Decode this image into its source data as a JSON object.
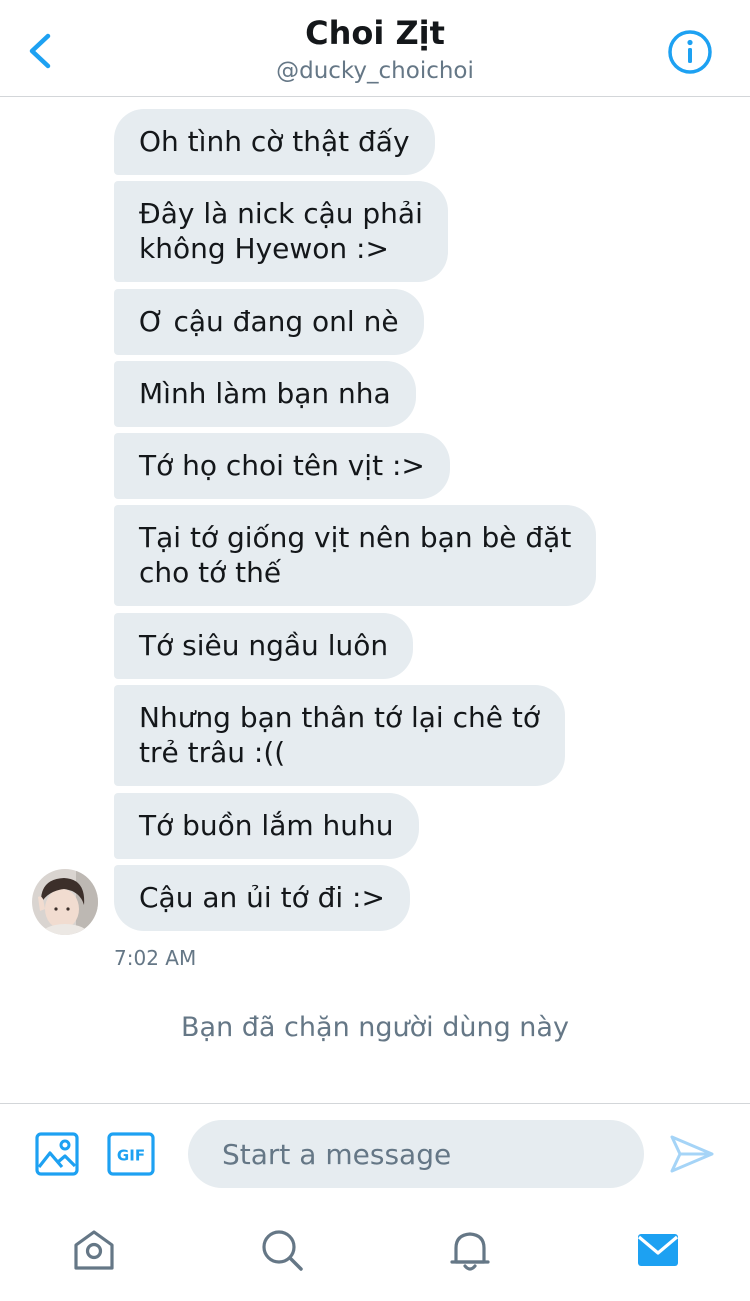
{
  "header": {
    "title": "Choi Zịt",
    "handle": "@ducky_choichoi",
    "back_icon": "chevron-left-icon",
    "info_icon": "info-icon"
  },
  "messages": [
    {
      "text": "Oh tình cờ thật đấy"
    },
    {
      "text": "Đây là nick cậu phải\nkhông Hyewon :>"
    },
    {
      "text": "Ơ cậu đang onl nè"
    },
    {
      "text": "Mình làm bạn nha"
    },
    {
      "text": "Tớ họ choi tên vịt :>"
    },
    {
      "text": "Tại tớ giống vịt nên bạn bè đặt\ncho tớ thế"
    },
    {
      "text": "Tớ siêu ngầu luôn"
    },
    {
      "text": "Nhưng bạn thân tớ lại chê tớ\ntrẻ trâu :(("
    },
    {
      "text": "Tớ buồn lắm huhu"
    },
    {
      "text": "Cậu an ủi tớ đi :>"
    }
  ],
  "timestamp": "7:02 AM",
  "blocked_notice": "Bạn đã chặn người dùng này",
  "composer": {
    "placeholder": "Start a message",
    "value": "",
    "gif_label": "GIF",
    "media_icon": "image-icon",
    "send_icon": "send-icon"
  },
  "tabbar": {
    "items": [
      {
        "icon": "home-icon",
        "active": false
      },
      {
        "icon": "search-icon",
        "active": false
      },
      {
        "icon": "bell-icon",
        "active": false
      },
      {
        "icon": "mail-icon",
        "active": true
      }
    ]
  },
  "colors": {
    "accent": "#1da1f2",
    "bubble_bg": "#e6ecf0",
    "muted_text": "#657786",
    "divider": "#d3d6d9"
  }
}
